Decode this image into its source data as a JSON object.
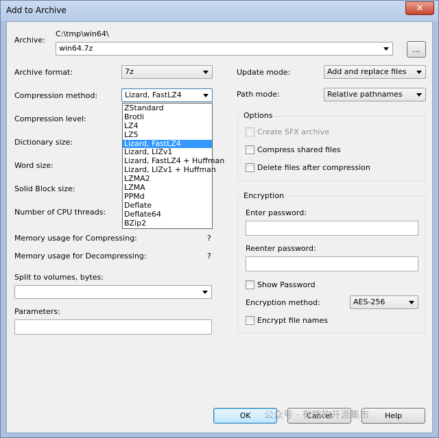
{
  "window": {
    "title": "Add to Archive",
    "close_label": "✕"
  },
  "archive": {
    "label": "Archive:",
    "path": "C:\\tmp\\win64\\",
    "value": "win64.7z",
    "browse_label": "..."
  },
  "left": {
    "archive_format": {
      "label": "Archive format:",
      "value": "7z"
    },
    "compression_method": {
      "label": "Compression method:",
      "value": "Lizard, FastLZ4"
    },
    "compression_level": {
      "label": "Compression level:"
    },
    "dictionary_size": {
      "label": "Dictionary size:"
    },
    "word_size": {
      "label": "Word size:"
    },
    "solid_block_size": {
      "label": "Solid Block size:"
    },
    "cpu_threads": {
      "label": "Number of CPU threads:"
    },
    "memory_compress": {
      "label": "Memory usage for Compressing:",
      "value": "?"
    },
    "memory_decompress": {
      "label": "Memory usage for Decompressing:",
      "value": "?"
    },
    "split_volumes": {
      "label": "Split to volumes, bytes:",
      "value": ""
    },
    "parameters": {
      "label": "Parameters:",
      "value": ""
    }
  },
  "method_dropdown": {
    "items": [
      "ZStandard",
      "Brotli",
      "LZ4",
      "LZ5",
      "Lizard, FastLZ4",
      "Lizard, LIZv1",
      "Lizard, FastLZ4 + Huffman",
      "Lizard, LIZv1 + Huffman",
      "LZMA2",
      "LZMA",
      "PPMd",
      "Deflate",
      "Deflate64",
      "BZip2"
    ],
    "selected_index": 4
  },
  "right": {
    "update_mode": {
      "label": "Update mode:",
      "value": "Add and replace files"
    },
    "path_mode": {
      "label": "Path mode:",
      "value": "Relative pathnames"
    },
    "options": {
      "title": "Options",
      "create_sfx": "Create SFX archive",
      "compress_shared": "Compress shared files",
      "delete_after": "Delete files after compression"
    },
    "encryption": {
      "title": "Encryption",
      "enter_password": "Enter password:",
      "reenter_password": "Reenter password:",
      "show_password": "Show Password",
      "method_label": "Encryption method:",
      "method_value": "AES-256",
      "encrypt_names": "Encrypt file names"
    }
  },
  "buttons": {
    "ok": "OK",
    "cancel": "Cancel",
    "help": "Help"
  },
  "watermark": "公众号 · 有趣的开源集市"
}
